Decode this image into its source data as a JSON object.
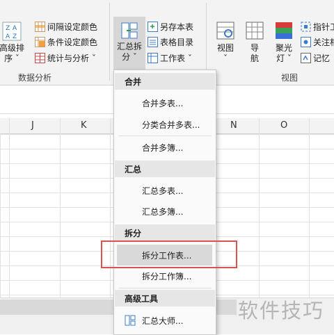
{
  "ribbon": {
    "sort_button": {
      "line1": "高级排",
      "line2": "序 ˇ"
    },
    "interval_color": "间隔设定颜色",
    "condition_color": "条件设定颜色",
    "stats_analysis": "统计与分析 ˇ",
    "group_data_analysis": "数据分析",
    "summary_split": {
      "line1": "汇总拆",
      "line2": "分 ˇ"
    },
    "save_as_sheet": "另存本表",
    "table_of_contents": "表格目录",
    "worksheet": "工作表 ˇ",
    "view_button": "视图",
    "view_arrow": "ˇ",
    "nav_button": {
      "line1": "导",
      "line2": "航"
    },
    "spotlight_button": {
      "line1": "聚光",
      "line2": "灯 ˇ"
    },
    "finger_ui": "指针工",
    "focus": "关注相",
    "memory": "记忆",
    "group_view": "视图"
  },
  "columns": [
    "J",
    "K",
    "N",
    "O"
  ],
  "menu": {
    "merge_header": "合并",
    "merge_sheets": "合并多表...",
    "classify_merge": "分类合并多表...",
    "merge_workbooks": "合并多簿...",
    "summary_header": "汇总",
    "summarize_sheets": "汇总多表...",
    "summarize_workbooks": "汇总多簿...",
    "split_header": "拆分",
    "split_worksheet_table": "拆分工作表...",
    "split_worksheet_book": "拆分工作簿...",
    "advanced_header": "高级工具",
    "summary_master": "汇总大师..."
  },
  "watermark": "软件技巧",
  "colors": {
    "highlight": "#d9d9d9",
    "redbox": "#d9534f",
    "ribbon_bg": "#f3f3f3"
  }
}
